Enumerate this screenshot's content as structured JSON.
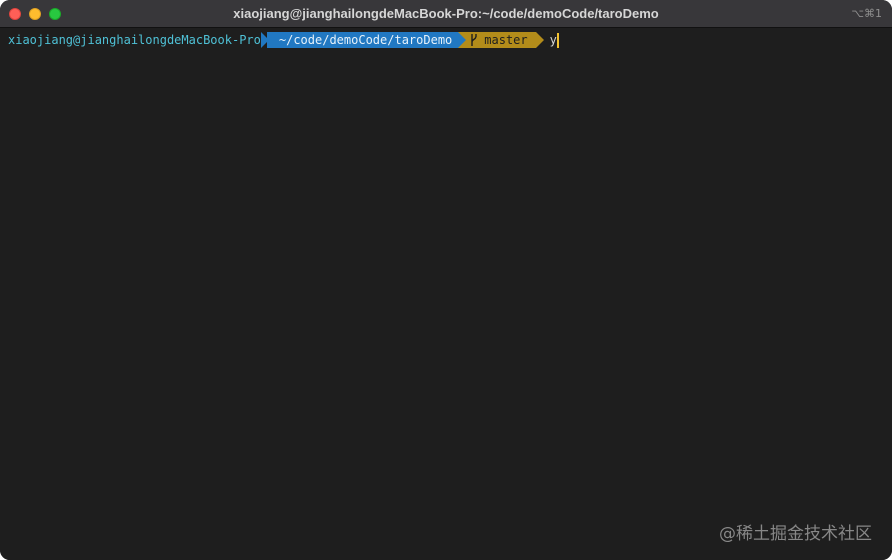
{
  "window": {
    "title": "xiaojiang@jianghailongdeMacBook-Pro:~/code/demoCode/taroDemo",
    "shortcut": "⌥⌘1"
  },
  "prompt": {
    "user_host": "xiaojiang@jianghailongdeMacBook-Pro",
    "path": "~/code/demoCode/taroDemo",
    "branch_icon": "",
    "branch": "master",
    "input": "y"
  },
  "colors": {
    "background": "#1e1e1e",
    "titlebar": "#38373a",
    "path_segment": "#2178c2",
    "git_segment": "#b38c1a",
    "user_text": "#4fc1d6",
    "cursor": "#f2c230"
  },
  "icons": {
    "close": "close-icon",
    "minimize": "minimize-icon",
    "maximize": "maximize-icon",
    "branch": "git-branch-icon"
  },
  "watermark": "@稀土掘金技术社区"
}
